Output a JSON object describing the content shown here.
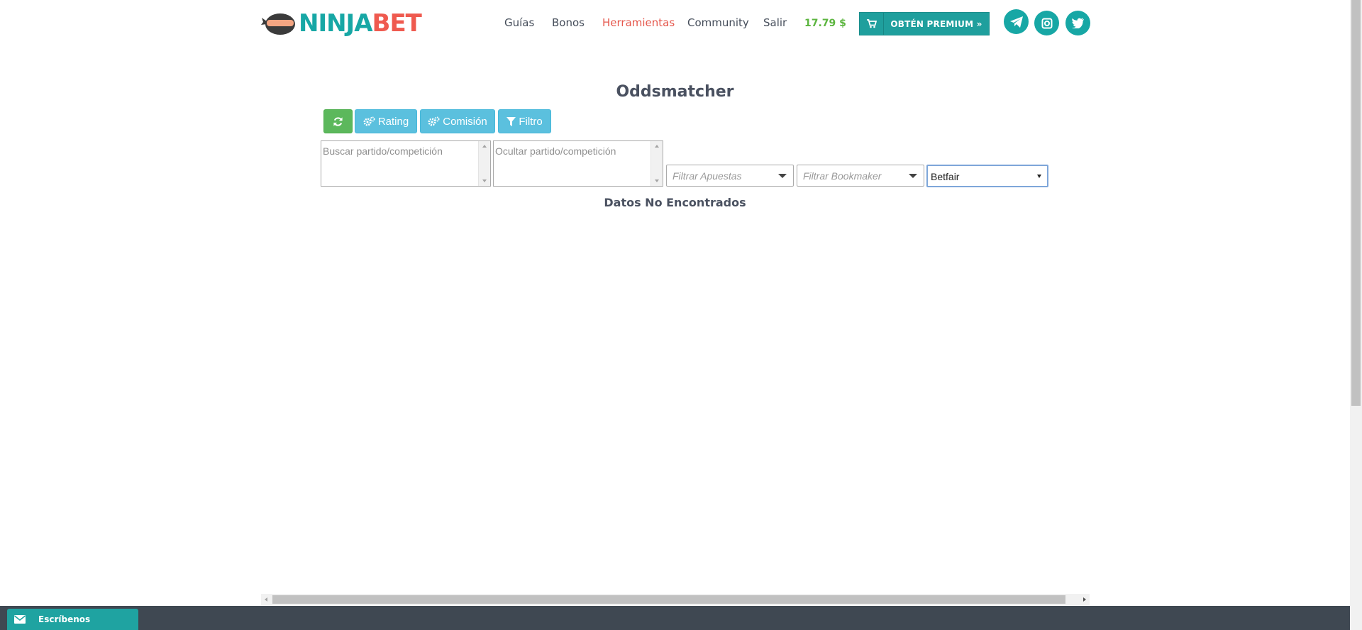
{
  "brand": {
    "part1": "NINJA",
    "part2": "BET"
  },
  "nav": {
    "items": [
      {
        "label": "Guías"
      },
      {
        "label": "Bonos"
      },
      {
        "label": "Herramientas",
        "active": true
      },
      {
        "label": "Community"
      },
      {
        "label": "Salir"
      }
    ],
    "balance": "17.79 $",
    "premium_label": "OBTÉN PREMIUM »",
    "social_icons": [
      "telegram-icon",
      "instagram-icon",
      "twitter-icon"
    ]
  },
  "main": {
    "title": "Oddsmatcher",
    "toolbar": {
      "refresh_icon": "refresh-icon",
      "rating_label": "Rating",
      "comision_label": "Comisión",
      "filtro_label": "Filtro"
    },
    "filters": {
      "search_placeholder": "Buscar partido/competición",
      "hide_placeholder": "Ocultar partido/competición",
      "bets_placeholder": "Filtrar Apuestas",
      "bookmaker_placeholder": "Filtrar Bookmaker",
      "exchange_value": "Betfair"
    },
    "empty_message": "Datos No Encontrados"
  },
  "footer": {
    "chat_label": "Escríbenos"
  },
  "colors": {
    "brand_teal": "#17a7a5",
    "brand_red": "#ef5a4f",
    "active_nav": "#e5574c",
    "balance_green": "#5cb53f",
    "btn_green": "#5cb85c",
    "btn_blue": "#5bc0de",
    "footer_bg": "#3f4852"
  }
}
